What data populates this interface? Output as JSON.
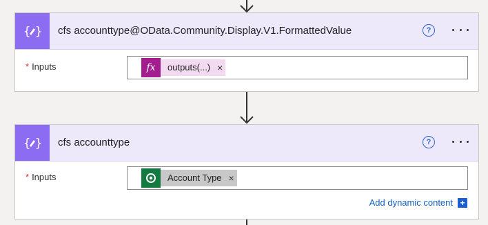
{
  "action1": {
    "title": "cfs accounttype@OData.Community.Display.V1.FormattedValue",
    "field_label": "Inputs",
    "required_mark": "*",
    "token": {
      "label": "outputs(...)",
      "icon": "fx-icon",
      "icon_text": "fx",
      "close": "×"
    },
    "help": "?"
  },
  "action2": {
    "title": "cfs accounttype",
    "field_label": "Inputs",
    "required_mark": "*",
    "token": {
      "label": "Account Type",
      "icon": "dataverse-icon",
      "close": "×"
    },
    "help": "?",
    "add_dynamic": "Add dynamic content",
    "add_dynamic_plus": "+"
  },
  "colors": {
    "header_bg": "#ede9fb",
    "action_icon_bg": "#8c6cf0",
    "expression_token_bg": "#f2dbf0",
    "expression_icon_bg": "#a31d8e",
    "dynamic_token_bg": "#c8c8c8",
    "dataverse_icon_bg": "#147a42",
    "link": "#0f5ec0"
  }
}
